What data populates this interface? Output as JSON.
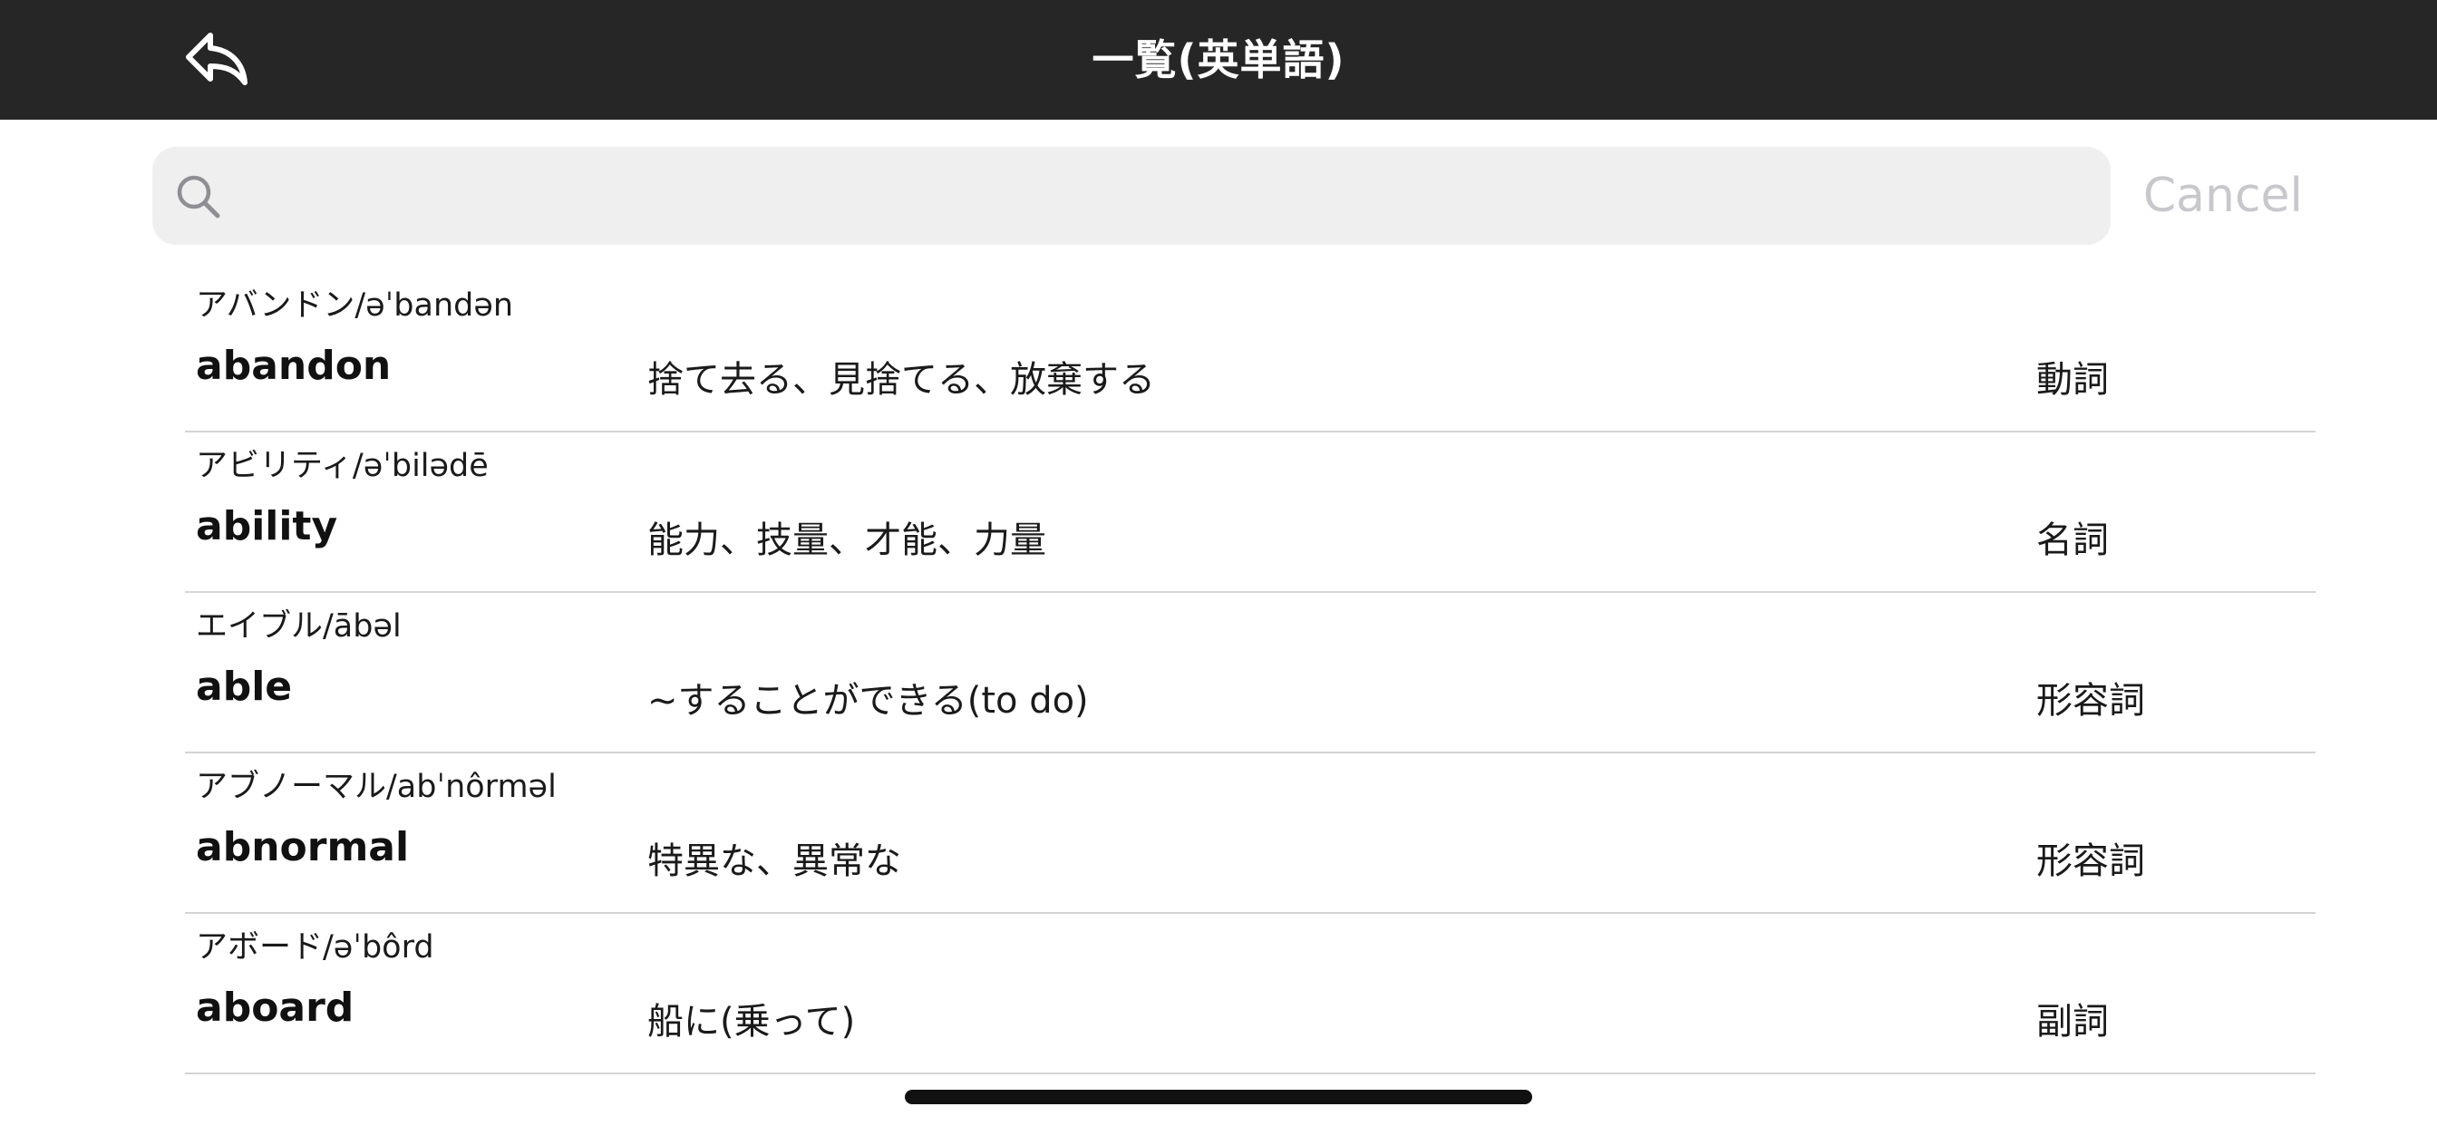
{
  "header": {
    "title": "一覧(英単語)",
    "back_icon": "back-arrow-icon"
  },
  "search": {
    "placeholder": "",
    "value": "",
    "icon": "search-icon",
    "cancel_label": "Cancel"
  },
  "colors": {
    "header_bg": "#262626",
    "search_bg": "#efefef",
    "cancel_text": "#c7c7cc",
    "divider": "#d4d4d4"
  },
  "words": [
    {
      "reading": "アバンドン/əˈbandən",
      "word": "abandon",
      "meaning": "捨て去る、見捨てる、放棄する",
      "pos": "動詞"
    },
    {
      "reading": "アビリティ/əˈbilədē",
      "word": "ability",
      "meaning": "能力、技量、才能、力量",
      "pos": "名詞"
    },
    {
      "reading": "エイブル/ābəl",
      "word": "able",
      "meaning": "~することができる(to do)",
      "pos": "形容詞"
    },
    {
      "reading": "アブノーマル/abˈnôrməl",
      "word": "abnormal",
      "meaning": "特異な、異常な",
      "pos": "形容詞"
    },
    {
      "reading": "アボード/əˈbôrd",
      "word": "aboard",
      "meaning": "船に(乗って)",
      "pos": "副詞"
    }
  ]
}
